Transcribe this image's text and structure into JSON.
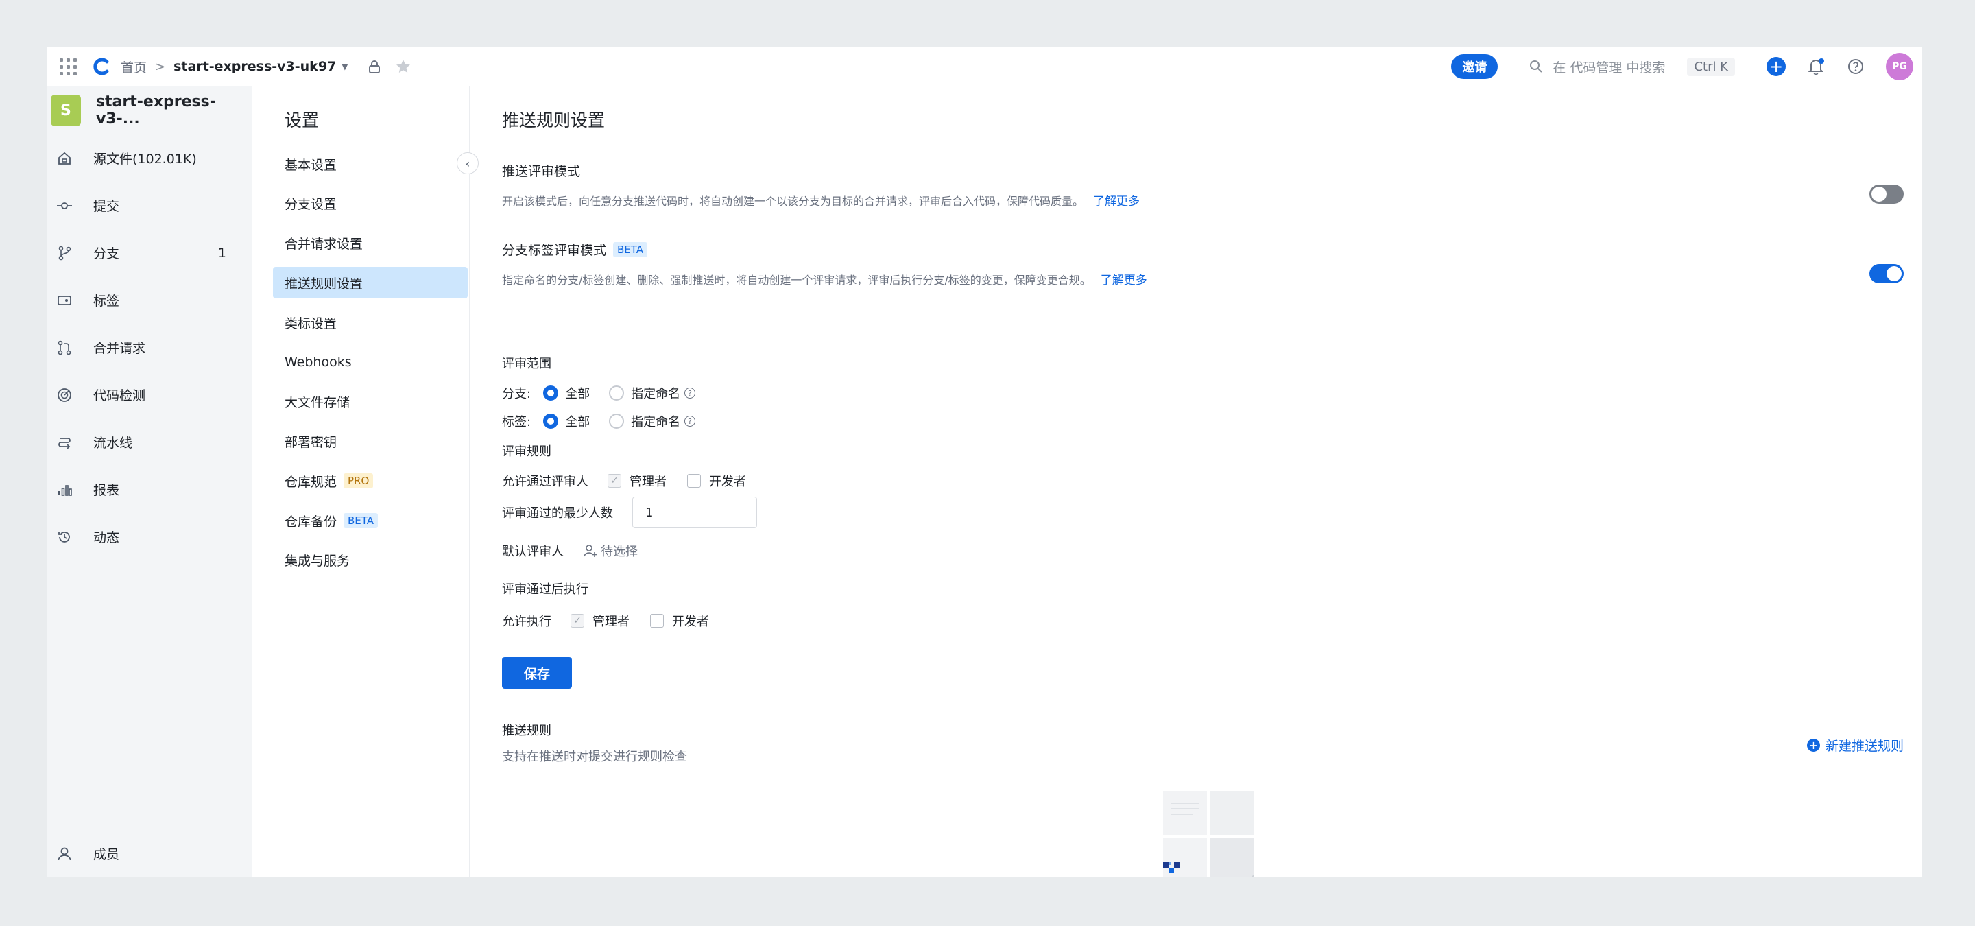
{
  "topbar": {
    "breadcrumb_home": "首页",
    "breadcrumb_sep": ">",
    "repo": "start-express-v3-uk97",
    "invite": "邀请",
    "search_placeholder": "在 代码管理 中搜索",
    "shortcut": "Ctrl K",
    "plus": "+",
    "avatar": "PG"
  },
  "leftnav": {
    "repo_badge": "S",
    "repo_name": "start-express-v3-...",
    "items": [
      {
        "icon": "home-icon",
        "label": "源文件(102.01K)"
      },
      {
        "icon": "commit-icon",
        "label": "提交"
      },
      {
        "icon": "branch-icon",
        "label": "分支",
        "count": "1"
      },
      {
        "icon": "tag-icon",
        "label": "标签"
      },
      {
        "icon": "merge-request-icon",
        "label": "合并请求"
      },
      {
        "icon": "code-scan-icon",
        "label": "代码检测"
      },
      {
        "icon": "pipeline-icon",
        "label": "流水线"
      },
      {
        "icon": "chart-icon",
        "label": "报表"
      },
      {
        "icon": "history-icon",
        "label": "动态"
      }
    ],
    "bottom_item": {
      "icon": "user-icon",
      "label": "成员"
    }
  },
  "settings": {
    "title": "设置",
    "items": [
      {
        "label": "基本设置"
      },
      {
        "label": "分支设置"
      },
      {
        "label": "合并请求设置"
      },
      {
        "label": "推送规则设置",
        "active": true
      },
      {
        "label": "类标设置"
      },
      {
        "label": "Webhooks"
      },
      {
        "label": "大文件存储"
      },
      {
        "label": "部署密钥"
      },
      {
        "label": "仓库规范",
        "tag": "PRO"
      },
      {
        "label": "仓库备份",
        "tag": "BETA"
      },
      {
        "label": "集成与服务"
      }
    ]
  },
  "main": {
    "title": "推送规则设置",
    "push_review": {
      "title": "推送评审模式",
      "desc": "开启该模式后，向任意分支推送代码时，将自动创建一个以该分支为目标的合并请求，评审后合入代码，保障代码质量。",
      "link": "了解更多",
      "enabled": false
    },
    "branch_tag_review": {
      "title": "分支标签评审模式",
      "badge": "BETA",
      "desc": "指定命名的分支/标签创建、删除、强制推送时，将自动创建一个评审请求，评审后执行分支/标签的变更，保障变更合规。",
      "link": "了解更多",
      "enabled": true
    },
    "scope": {
      "title": "评审范围",
      "branch_label": "分支:",
      "tag_label": "标签:",
      "opt_all": "全部",
      "opt_named": "指定命名",
      "help": "?"
    },
    "rules": {
      "title": "评审规则",
      "allow_label": "允许通过评审人",
      "admin": "管理者",
      "dev": "开发者",
      "min_label": "评审通过的最少人数",
      "min_value": "1",
      "default_label": "默认评审人",
      "default_value": "待选择"
    },
    "after": {
      "title": "评审通过后执行",
      "allow_label": "允许执行",
      "admin": "管理者",
      "dev": "开发者"
    },
    "save": "保存",
    "push_rules": {
      "title": "推送规则",
      "desc": "支持在推送时对提交进行规则检查",
      "new": "新建推送规则"
    }
  },
  "colors": {
    "accent": "#1067e0",
    "active_menu": "#cde6fd",
    "repo_badge": "#a8cc54",
    "avatar": "#cd7ad8"
  }
}
